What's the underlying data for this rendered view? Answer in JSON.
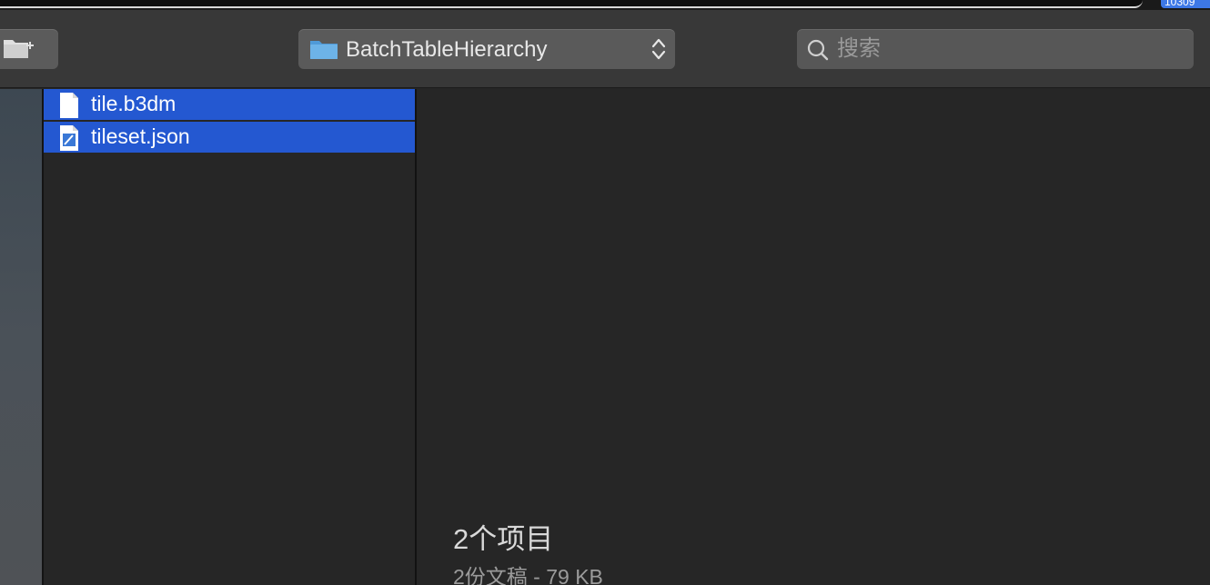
{
  "top_bar": {
    "badge_text": "10309"
  },
  "toolbar": {
    "new_folder_icon": "new-folder-icon",
    "path_popup": {
      "label": "BatchTableHierarchy",
      "icon": "folder-icon"
    },
    "search": {
      "placeholder": "搜索",
      "value": ""
    }
  },
  "files": [
    {
      "name": "tile.b3dm",
      "icon": "document-icon",
      "selected": true
    },
    {
      "name": "tileset.json",
      "icon": "json-document-icon",
      "selected": true
    }
  ],
  "preview": {
    "count_title": "2个项目",
    "count_subtitle": "2份文稿 - 79 KB"
  },
  "colors": {
    "selection": "#2458d1",
    "toolbar": "#383838",
    "background": "#262626",
    "folder_blue": "#6db3e8"
  }
}
